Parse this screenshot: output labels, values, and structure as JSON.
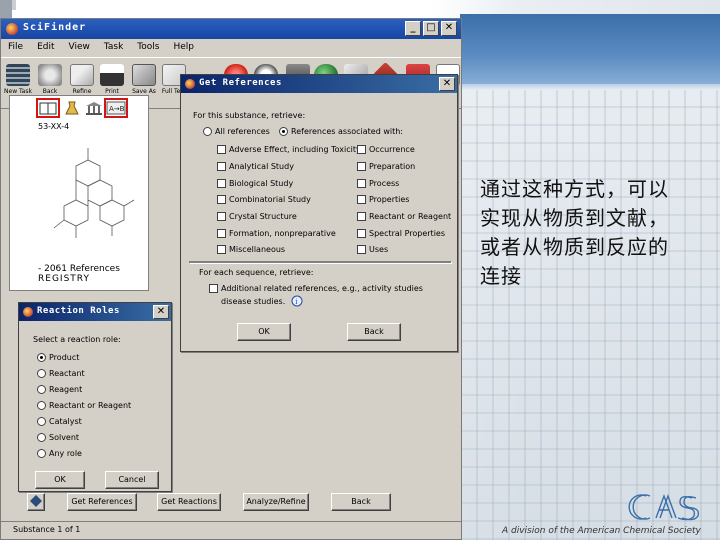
{
  "window": {
    "title": "SciFinder"
  },
  "menu": [
    "File",
    "Edit",
    "View",
    "Task",
    "Tools",
    "Help"
  ],
  "toolbar": {
    "items": [
      {
        "label": "New Task",
        "icon": "new-task-icon"
      },
      {
        "label": "Back",
        "icon": "back-icon"
      },
      {
        "label": "Refine",
        "icon": "refine-icon"
      },
      {
        "label": "Print",
        "icon": "print-icon"
      },
      {
        "label": "Save As",
        "icon": "save-icon"
      },
      {
        "label": "Full Text",
        "icon": "full-text-icon"
      }
    ]
  },
  "structure_panel": {
    "reg_number": "53-XX-4",
    "ref_count": "- 2061 References",
    "registry": "REGISTRY"
  },
  "get_references": {
    "title": "Get References",
    "intro": "For this substance, retrieve:",
    "radio_all": "All references",
    "radio_associated": "References associated with:",
    "left_checks": [
      "Adverse Effect, including Toxicity",
      "Analytical Study",
      "Biological Study",
      "Combinatorial Study",
      "Crystal Structure",
      "Formation, nonpreparative",
      "Miscellaneous"
    ],
    "right_checks": [
      "Occurrence",
      "Preparation",
      "Process",
      "Properties",
      "Reactant or Reagent",
      "Spectral Properties",
      "Uses"
    ],
    "sequence_label": "For each sequence, retrieve:",
    "additional": "Additional related references, e.g., activity studies",
    "disease": "disease studies.",
    "ok": "OK",
    "back": "Back"
  },
  "reaction_roles": {
    "title": "Reaction Roles",
    "prompt": "Select a reaction role:",
    "roles": [
      "Product",
      "Reactant",
      "Reagent",
      "Reactant or Reagent",
      "Catalyst",
      "Solvent",
      "Any role"
    ],
    "selected": "Product",
    "ok": "OK",
    "cancel": "Cancel"
  },
  "bottom_buttons": [
    "Get References",
    "Get Reactions",
    "Analyze/Refine",
    "Back"
  ],
  "status": "Substance 1 of 1",
  "caption": "通过这种方式，可以实现从物质到文献，或者从物质到反应的连接",
  "cas": {
    "logo_text": "CAS",
    "division": "A division of the American Chemical Society"
  },
  "colors": {
    "title_blue": "#1846a3",
    "dialog_blue": "#0a246a",
    "highlight_red": "#d01616"
  }
}
